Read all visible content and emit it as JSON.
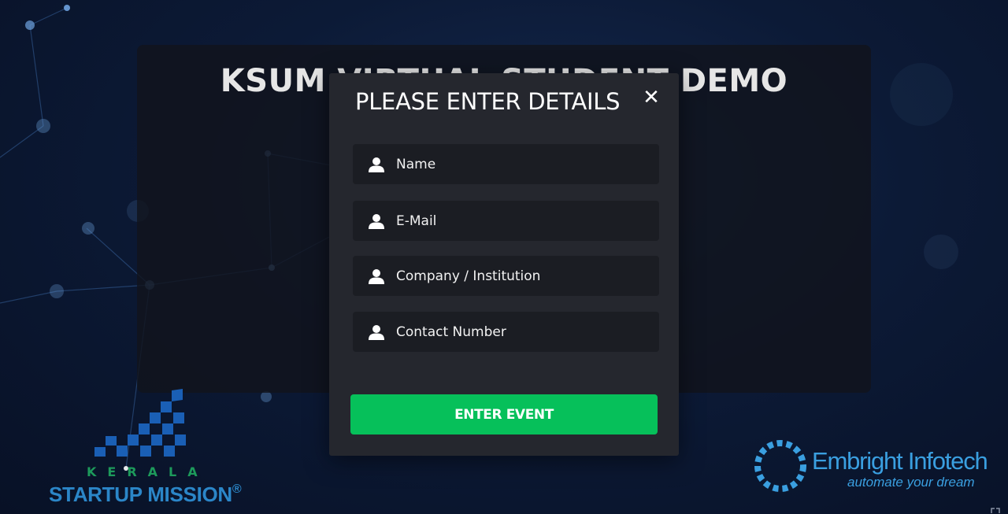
{
  "background": {
    "panel_title": "KSUM VIRTUAL STUDENT DEMO"
  },
  "modal": {
    "title": "PLEASE ENTER DETAILS",
    "close_icon": "close-icon",
    "fields": [
      {
        "placeholder": "Name",
        "value": "",
        "icon": "user-icon"
      },
      {
        "placeholder": "E-Mail",
        "value": "",
        "icon": "user-icon"
      },
      {
        "placeholder": "Company / Institution",
        "value": "",
        "icon": "user-icon"
      },
      {
        "placeholder": "Contact Number",
        "value": "",
        "icon": "user-icon"
      }
    ],
    "submit_label": "ENTER EVENT"
  },
  "logos": {
    "ksum": {
      "top_word": "KERALA",
      "name": "STARTUP MISSION",
      "registered": "®"
    },
    "embright": {
      "name": "Embright Infotech",
      "tagline": "automate your dream"
    }
  },
  "colors": {
    "accent_green": "#06c05a",
    "modal_bg": "#25272e",
    "field_bg": "#1b1d23",
    "brand_blue": "#3a9fe0",
    "ksum_green": "#1d9a5b"
  }
}
